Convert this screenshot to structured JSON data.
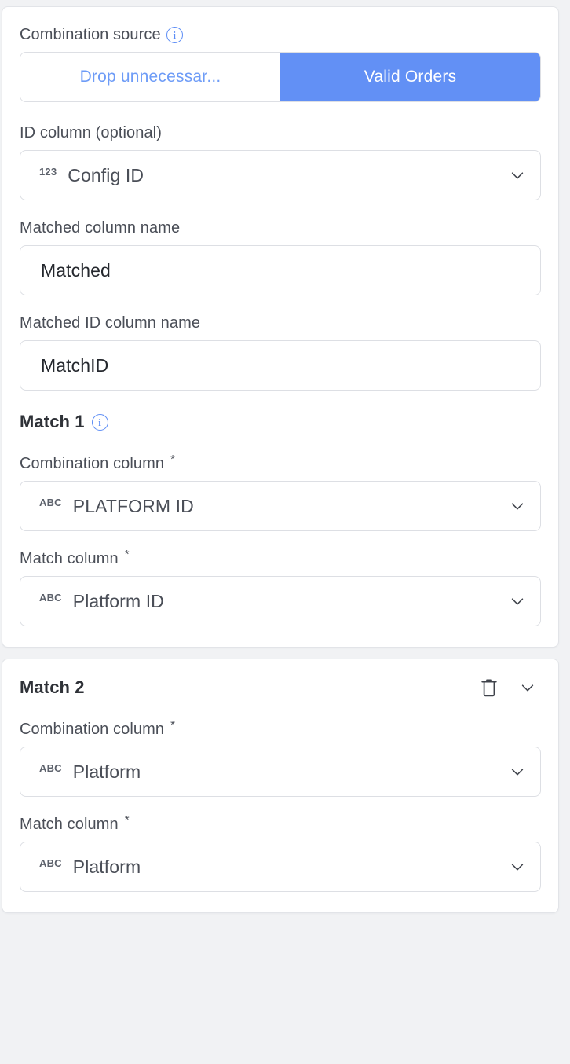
{
  "theme": {
    "accent_blue": "#6290f5",
    "accent_blue_text": "#6e9cf7",
    "label_gray": "#4a4e57",
    "value_dark": "#25282e",
    "border": "#dddfe4",
    "page_bg": "#f1f2f4"
  },
  "card1": {
    "combination_source": {
      "label": "Combination source",
      "info_icon": "info-icon",
      "options": [
        {
          "label": "Drop unnecessar...",
          "selected": false
        },
        {
          "label": "Valid Orders",
          "selected": true
        }
      ]
    },
    "id_column": {
      "label": "ID column (optional)",
      "type_badge": "123",
      "value": "Config ID",
      "chevron_icon": "chevron-down-icon"
    },
    "matched_column_name": {
      "label": "Matched column name",
      "value": "Matched"
    },
    "matched_id_column_name": {
      "label": "Matched ID column name",
      "value": "MatchID"
    },
    "match1": {
      "title": "Match 1",
      "info_icon": "info-icon",
      "combination_column": {
        "label": "Combination column",
        "required_mark": "*",
        "type_badge": "ABC",
        "value": "PLATFORM ID",
        "chevron_icon": "chevron-down-icon"
      },
      "match_column": {
        "label": "Match column",
        "required_mark": "*",
        "type_badge": "ABC",
        "value": "Platform ID",
        "chevron_icon": "chevron-down-icon"
      }
    }
  },
  "card2": {
    "match2": {
      "title": "Match 2",
      "delete_icon": "trash-icon",
      "collapse_icon": "chevron-down-icon",
      "combination_column": {
        "label": "Combination column",
        "required_mark": "*",
        "type_badge": "ABC",
        "value": "Platform",
        "chevron_icon": "chevron-down-icon"
      },
      "match_column": {
        "label": "Match column",
        "required_mark": "*",
        "type_badge": "ABC",
        "value": "Platform",
        "chevron_icon": "chevron-down-icon"
      }
    }
  }
}
